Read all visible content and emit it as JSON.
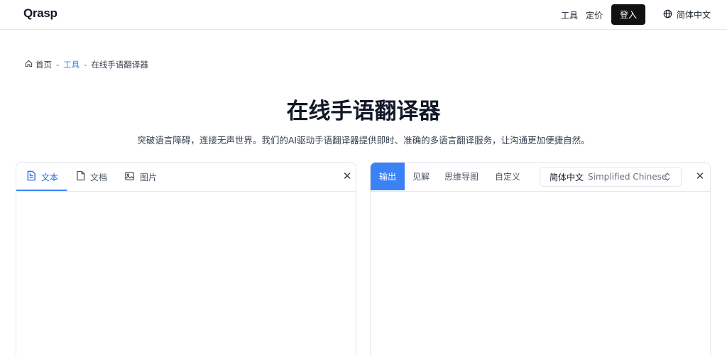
{
  "header": {
    "logo": "Qrasp",
    "nav": {
      "tools": "工具",
      "pricing": "定价",
      "login": "登入",
      "language": "简体中文"
    }
  },
  "breadcrumb": {
    "home": "首页",
    "separator": "-",
    "tools": "工具",
    "current": "在线手语翻译器"
  },
  "hero": {
    "title": "在线手语翻译器",
    "subtitle": "突破语言障碍，连接无声世界。我们的AI驱动手语翻译器提供即时、准确的多语言翻译服务，让沟通更加便捷自然。"
  },
  "input_panel": {
    "tabs": [
      {
        "label": "文本",
        "icon": "text-file-icon",
        "active": true
      },
      {
        "label": "文档",
        "icon": "document-icon",
        "active": false
      },
      {
        "label": "图片",
        "icon": "image-icon",
        "active": false
      }
    ],
    "close_icon": "close-icon"
  },
  "output_panel": {
    "tabs": [
      {
        "label": "输出",
        "active": true
      },
      {
        "label": "见解",
        "active": false
      },
      {
        "label": "思维导图",
        "active": false
      },
      {
        "label": "自定义",
        "active": false
      }
    ],
    "language_select": {
      "main": "简体中文",
      "sub": "Simplified Chinese",
      "icon": "chevron-updown-icon"
    },
    "close_icon": "close-icon"
  },
  "colors": {
    "accent": "#3b82f6",
    "login_bg": "#111111",
    "border": "#e5e7eb"
  }
}
